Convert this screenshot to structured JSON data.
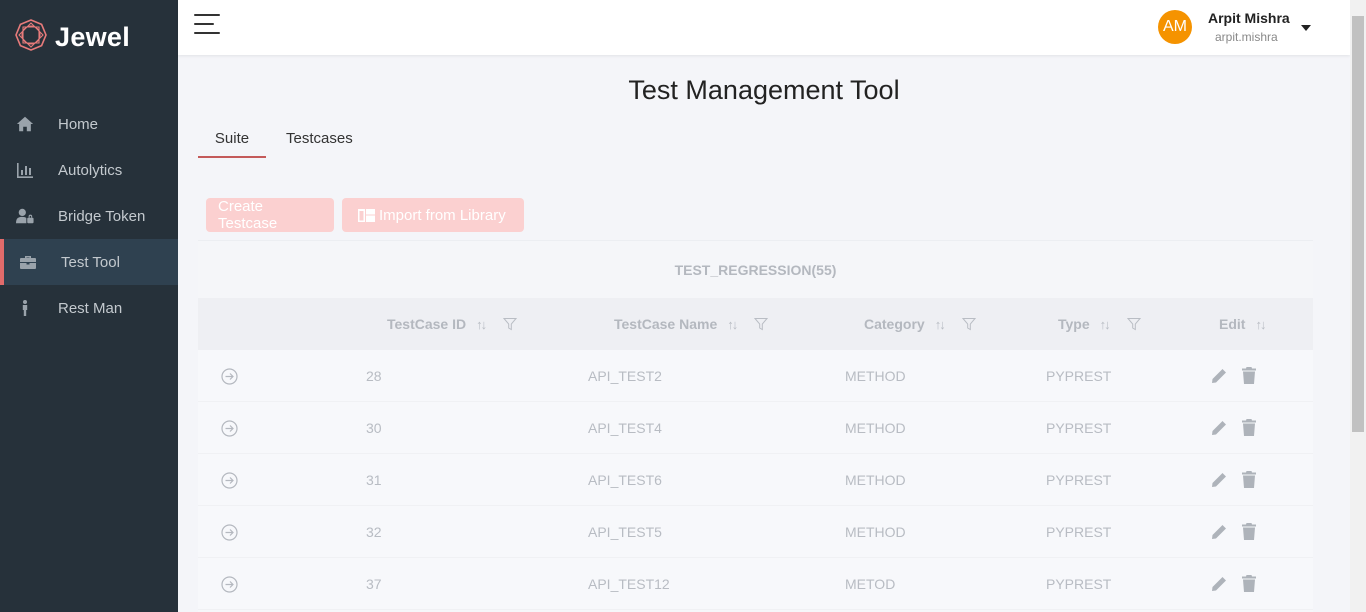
{
  "app": {
    "name": "Jewel"
  },
  "sidebar": {
    "items": [
      {
        "label": "Home",
        "icon": "home-icon",
        "active": false
      },
      {
        "label": "Autolytics",
        "icon": "bar-chart-icon",
        "active": false
      },
      {
        "label": "Bridge Token",
        "icon": "user-lock-icon",
        "active": false
      },
      {
        "label": "Test Tool",
        "icon": "toolbox-icon",
        "active": true
      },
      {
        "label": "Rest Man",
        "icon": "person-icon",
        "active": false
      }
    ]
  },
  "header": {
    "user": {
      "initials": "AM",
      "name": "Arpit Mishra",
      "handle": "arpit.mishra"
    }
  },
  "main": {
    "title": "Test Management Tool",
    "tabs": [
      {
        "label": "Suite",
        "active": true
      },
      {
        "label": "Testcases",
        "active": false
      }
    ],
    "buttons": {
      "create": "Create Testcase",
      "import": "Import from Library"
    },
    "suite": {
      "title": "TEST_REGRESSION(55)",
      "columns": [
        "TestCase ID",
        "TestCase Name",
        "Category",
        "Type",
        "Edit"
      ],
      "rows": [
        {
          "id": "28",
          "name": "API_TEST2",
          "category": "METHOD",
          "type": "PYPREST"
        },
        {
          "id": "30",
          "name": "API_TEST4",
          "category": "METHOD",
          "type": "PYPREST"
        },
        {
          "id": "31",
          "name": "API_TEST6",
          "category": "METHOD",
          "type": "PYPREST"
        },
        {
          "id": "32",
          "name": "API_TEST5",
          "category": "METHOD",
          "type": "PYPREST"
        },
        {
          "id": "37",
          "name": "API_TEST12",
          "category": "METOD",
          "type": "PYPREST"
        }
      ]
    }
  },
  "colors": {
    "sidebar_bg": "#26313a",
    "active_accent": "#e16b6b",
    "button_bg": "#fbd0d0",
    "avatar_bg": "#f59300"
  }
}
